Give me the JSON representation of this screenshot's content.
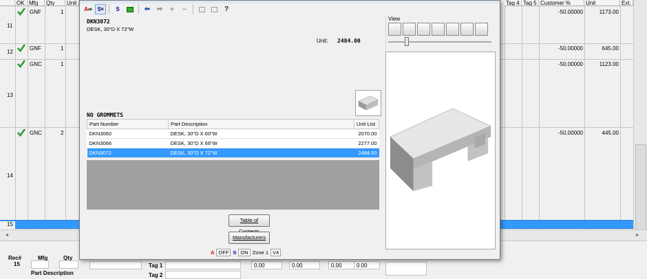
{
  "grid": {
    "headers": {
      "ok": "OK",
      "mfg": "Mfg",
      "qty": "Qty",
      "unit": "Unit",
      "tag4": "Tag 4",
      "tag5": "Tag 5",
      "customer_pct": "Customer %",
      "unit_price": "Unit",
      "ext": "Ext."
    },
    "rows": [
      {
        "num": "11",
        "mfg": "GNF",
        "qty": "1",
        "customer": "-50.00000",
        "unit": "1173.00",
        "checked": true
      },
      {
        "num": "12",
        "mfg": "GNF",
        "qty": "1",
        "customer": "-50.00000",
        "unit": "645.00",
        "checked": true
      },
      {
        "num": "13",
        "mfg": "GNC",
        "qty": "1",
        "customer": "-50.00000",
        "unit": "1123.00",
        "checked": true
      },
      {
        "num": "14",
        "mfg": "GNC",
        "qty": "2",
        "customer": "-50.00000",
        "unit": "445.00",
        "checked": true
      },
      {
        "num": "15",
        "mfg": "",
        "qty": "",
        "customer": "",
        "unit": "",
        "checked": false
      }
    ]
  },
  "lower_panel": {
    "rec_label": "Rec#",
    "rec_value": "15",
    "mfg_label": "Mfg",
    "qty_label": "Qty",
    "part_desc_label": "Part Description",
    "tag1_label": "Tag 1",
    "tag2_label": "Tag 2",
    "amounts": [
      "0.00",
      "0.00",
      "0.00",
      "0.00"
    ]
  },
  "dialog": {
    "part_code": "DKN3072",
    "part_desc": "DESK, 30\"D X 72\"W",
    "unit_label": "Unit:",
    "unit_value": "2484.00",
    "group_title": "NO GROMMETS",
    "table": {
      "headers": [
        "Part Number",
        "Part Description",
        "Unit List"
      ],
      "rows": [
        {
          "number": "DKN3060",
          "desc": "DESK, 30\"D X 60\"W",
          "list": "2070.00"
        },
        {
          "number": "DKN3066",
          "desc": "DESK, 30\"D X 66\"W",
          "list": "2277.00"
        },
        {
          "number": "DKN3072",
          "desc": "DESK, 30\"D X 72\"W",
          "list": "2484.00"
        }
      ],
      "selected_index": 2
    },
    "buttons": {
      "toc": "Table of Contents",
      "manufacturers": "Manufacturers"
    },
    "status": {
      "off": "OFF",
      "on": "ON",
      "zone": "Zone 1",
      "version": "V4"
    },
    "view_label": "View",
    "accent": "#3399ff"
  }
}
